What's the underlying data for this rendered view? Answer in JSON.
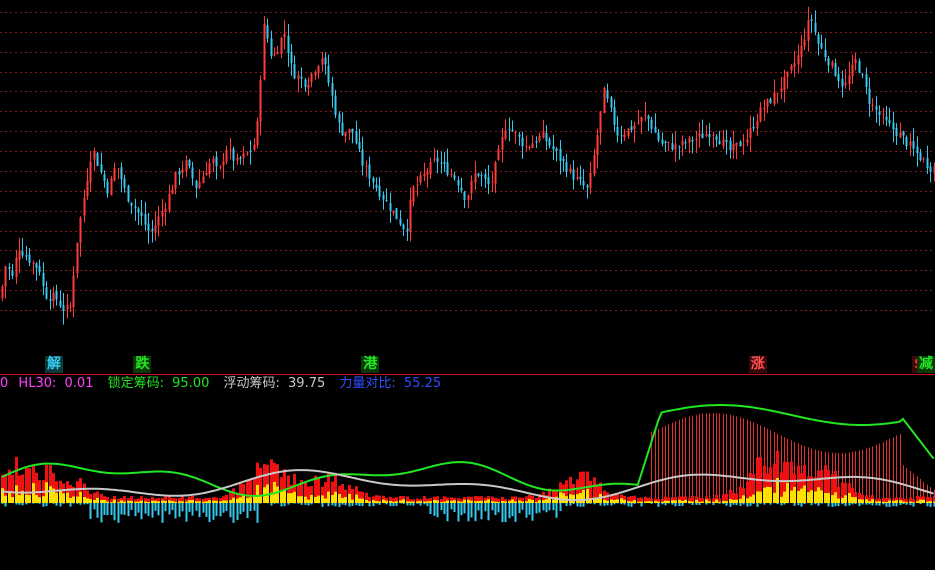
{
  "colors": {
    "up": "#ff3b3b",
    "down": "#37c8ee",
    "grid": "#8a1a1a",
    "lock_line": "#22e622",
    "float_line": "#c8c8c8",
    "hl30": "#ff40ff",
    "power": "#3050ff",
    "divider": "#d01010",
    "yellow": "#ffe000"
  },
  "indicator_legend": {
    "prefix": "0",
    "hl30_label": "HL30:",
    "hl30_value": "0.01",
    "lock_label": "锁定筹码:",
    "lock_value": "95.00",
    "float_label": "浮动筹码:",
    "float_value": "39.75",
    "power_label": "力量对比:",
    "power_value": "55.25"
  },
  "markers": [
    {
      "text": "解",
      "bar": 15,
      "color": "#37c8ee",
      "bg": "#0a3a3a"
    },
    {
      "text": "跌",
      "bar": 41,
      "color": "#22e622",
      "bg": "#0a3a0a"
    },
    {
      "text": "港",
      "bar": 108,
      "color": "#22e622",
      "bg": "#0a3a0a"
    },
    {
      "text": "涨",
      "bar": 222,
      "color": "#ff5050",
      "bg": "#3a0a0a"
    },
    {
      "text": "$",
      "bar": 270,
      "color": "#ff3030",
      "bg": "#3a0a0a"
    },
    {
      "text": "减",
      "bar": 278,
      "color": "#22e622",
      "bg": "#0a3a0a"
    }
  ],
  "chart_data": {
    "type": "candlestick",
    "title": "",
    "price_levels": [
      16.0,
      16.5,
      17.0,
      17.5,
      18.0,
      18.5,
      19.0,
      19.5,
      20.0,
      20.5,
      21.0,
      21.5,
      22.0,
      22.5,
      23.0,
      23.5
    ],
    "ylim": [
      15.5,
      23.8
    ],
    "anchors": [
      [
        0,
        16.3
      ],
      [
        6,
        17.2
      ],
      [
        12,
        16.8
      ],
      [
        18,
        17.6
      ],
      [
        28,
        17.3
      ],
      [
        40,
        17.0
      ],
      [
        44,
        16.4
      ],
      [
        56,
        16.3
      ],
      [
        64,
        16.0
      ],
      [
        72,
        16.1
      ],
      [
        74,
        17.3
      ],
      [
        82,
        18.6
      ],
      [
        92,
        20.1
      ],
      [
        100,
        19.5
      ],
      [
        108,
        19.0
      ],
      [
        116,
        19.7
      ],
      [
        126,
        18.9
      ],
      [
        142,
        18.3
      ],
      [
        150,
        17.9
      ],
      [
        166,
        18.7
      ],
      [
        176,
        19.4
      ],
      [
        186,
        19.7
      ],
      [
        196,
        19.1
      ],
      [
        212,
        19.8
      ],
      [
        218,
        19.4
      ],
      [
        226,
        20.1
      ],
      [
        236,
        19.7
      ],
      [
        250,
        20.0
      ],
      [
        256,
        20.3
      ],
      [
        264,
        23.2
      ],
      [
        272,
        22.3
      ],
      [
        284,
        23.0
      ],
      [
        292,
        22.0
      ],
      [
        306,
        21.7
      ],
      [
        322,
        22.4
      ],
      [
        340,
        20.5
      ],
      [
        352,
        20.5
      ],
      [
        362,
        19.7
      ],
      [
        376,
        19.1
      ],
      [
        392,
        18.5
      ],
      [
        406,
        18.0
      ],
      [
        412,
        19.0
      ],
      [
        436,
        19.8
      ],
      [
        456,
        19.3
      ],
      [
        466,
        18.8
      ],
      [
        476,
        19.5
      ],
      [
        490,
        19.1
      ],
      [
        506,
        20.7
      ],
      [
        526,
        20.1
      ],
      [
        542,
        20.4
      ],
      [
        554,
        20.0
      ],
      [
        572,
        19.4
      ],
      [
        588,
        19.0
      ],
      [
        604,
        21.5
      ],
      [
        618,
        20.4
      ],
      [
        632,
        20.6
      ],
      [
        646,
        20.9
      ],
      [
        660,
        20.2
      ],
      [
        676,
        20.1
      ],
      [
        694,
        20.3
      ],
      [
        712,
        20.5
      ],
      [
        730,
        20.0
      ],
      [
        746,
        20.3
      ],
      [
        760,
        21.0
      ],
      [
        774,
        21.4
      ],
      [
        788,
        21.9
      ],
      [
        800,
        22.5
      ],
      [
        810,
        23.4
      ],
      [
        818,
        22.7
      ],
      [
        830,
        22.2
      ],
      [
        844,
        21.6
      ],
      [
        856,
        22.3
      ],
      [
        870,
        21.2
      ],
      [
        886,
        20.7
      ],
      [
        900,
        20.4
      ],
      [
        914,
        20.0
      ],
      [
        930,
        19.6
      ]
    ],
    "indicator": {
      "series": [
        {
          "name": "锁定筹码",
          "value": 95.0
        },
        {
          "name": "浮动筹码",
          "value": 39.75
        },
        {
          "name": "力量对比",
          "value": 55.25
        },
        {
          "name": "HL30",
          "value": 0.01
        }
      ]
    }
  }
}
